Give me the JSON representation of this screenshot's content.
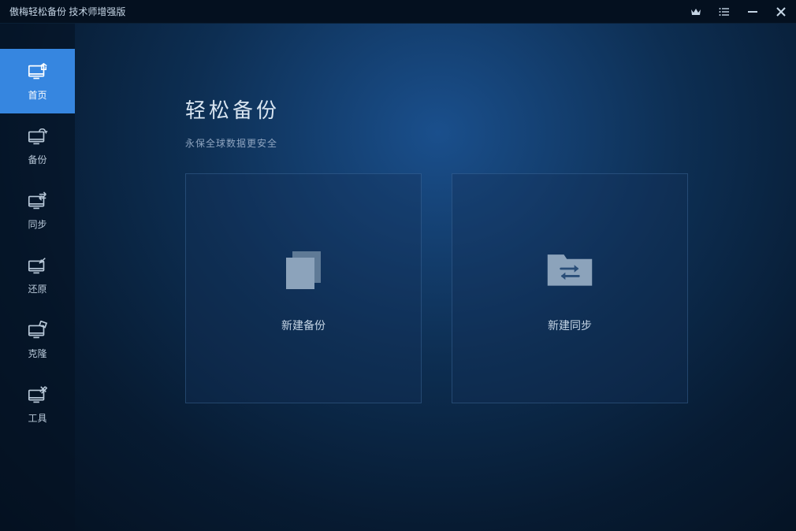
{
  "titlebar": {
    "title": "傲梅轻松备份 技术师增强版"
  },
  "sidebar": {
    "items": [
      {
        "label": "首页"
      },
      {
        "label": "备份"
      },
      {
        "label": "同步"
      },
      {
        "label": "还原"
      },
      {
        "label": "克隆"
      },
      {
        "label": "工具"
      }
    ]
  },
  "main": {
    "title": "轻松备份",
    "subtitle": "永保全球数据更安全",
    "cards": [
      {
        "label": "新建备份"
      },
      {
        "label": "新建同步"
      }
    ]
  }
}
